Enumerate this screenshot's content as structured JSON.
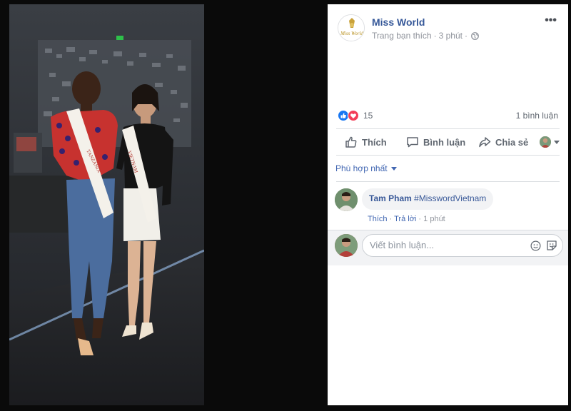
{
  "post": {
    "page_name": "Miss World",
    "relation": "Trang bạn thích",
    "time": "3 phút",
    "more": "•••",
    "logo_text": "Miss World"
  },
  "reactions": {
    "count": "15",
    "comments": "1 bình luận",
    "types": [
      "like-icon",
      "love-icon"
    ]
  },
  "actions": {
    "like": "Thích",
    "comment": "Bình luận",
    "share": "Chia sẻ"
  },
  "sort": {
    "label": "Phù hợp nhất"
  },
  "comments": [
    {
      "author": "Tam Pham",
      "text": "#MisswordVietnam",
      "like": "Thích",
      "reply": "Trả lời",
      "time": "1 phút"
    }
  ],
  "compose": {
    "placeholder": "Viết bình luận..."
  },
  "photo": {
    "sash_left": "TANZANIA",
    "sash_right": "VIETNAM"
  },
  "colors": {
    "brand": "#365899",
    "link": "#4267b2",
    "like": "#1877f2",
    "love": "#f33e58"
  }
}
